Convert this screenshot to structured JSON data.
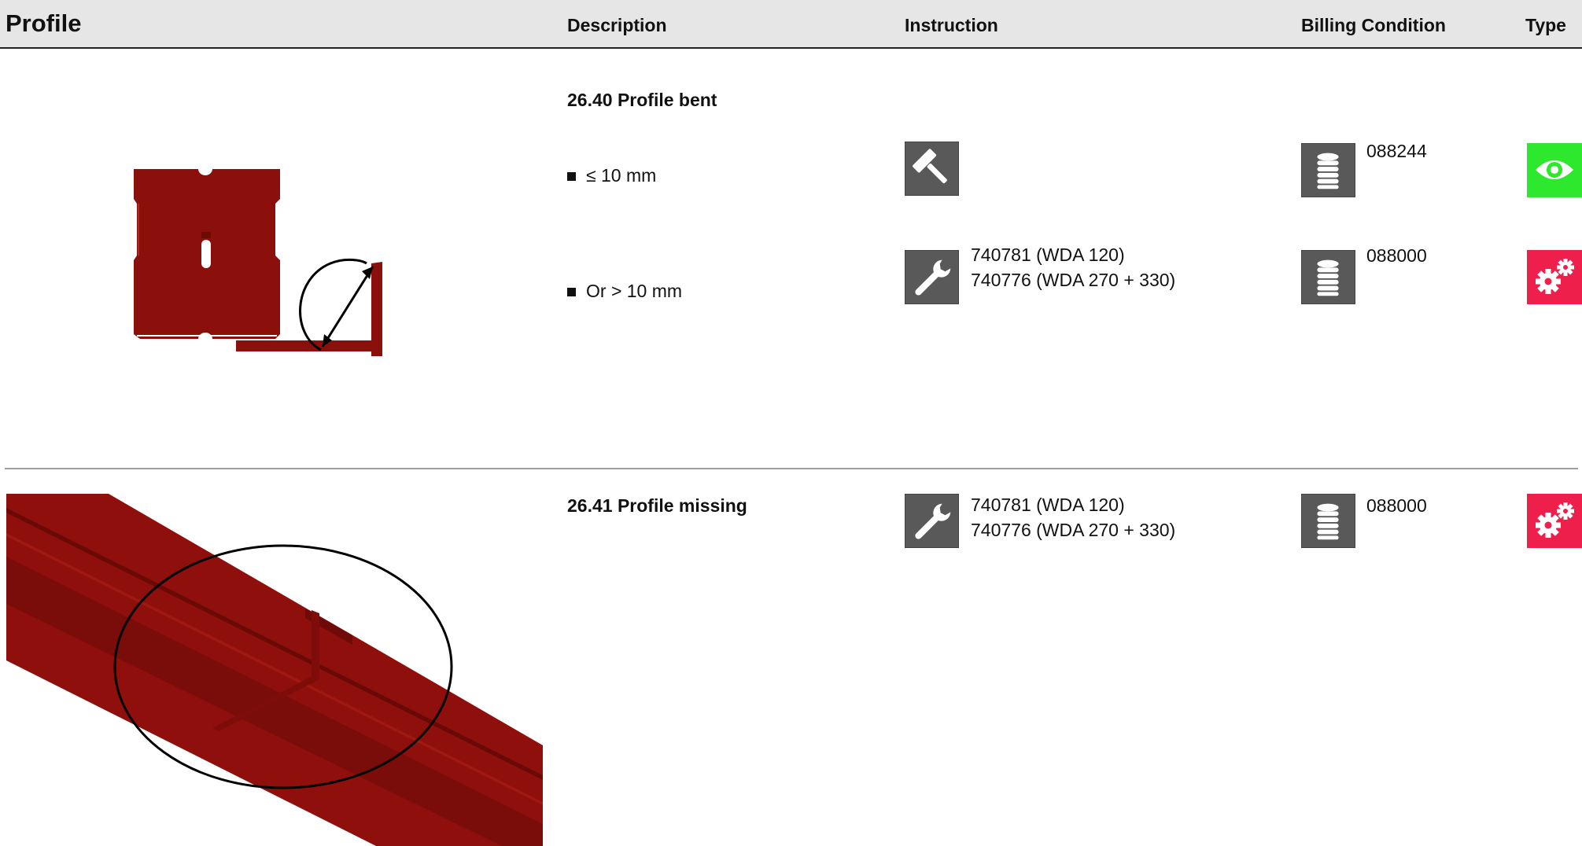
{
  "header": {
    "title": "Profile",
    "columns": {
      "description": "Description",
      "instruction": "Instruction",
      "billing": "Billing Condition",
      "type": "Type"
    }
  },
  "sections": [
    {
      "title": "26.40 Profile bent",
      "rows": [
        {
          "bullet": "≤ 10 mm",
          "instruction_icon": "hammer-icon",
          "instruction_lines": [],
          "billing_icon": "coin-stack-icon",
          "billing_code": "088244",
          "type_icon": "eye-icon",
          "type_color": "#2ee82e"
        },
        {
          "bullet": "Or > 10 mm",
          "instruction_icon": "wrench-icon",
          "instruction_lines": [
            "740781 (WDA 120)",
            "740776 (WDA 270 + 330)"
          ],
          "billing_icon": "coin-stack-icon",
          "billing_code": "088000",
          "type_icon": "gears-icon",
          "type_color": "#ee1f4a"
        }
      ]
    },
    {
      "title": "26.41 Profile missing",
      "rows": [
        {
          "instruction_icon": "wrench-icon",
          "instruction_lines": [
            "740781 (WDA 120)",
            "740776 (WDA 270 + 330)"
          ],
          "billing_icon": "coin-stack-icon",
          "billing_code": "088000",
          "type_icon": "gears-icon",
          "type_color": "#ee1f4a"
        }
      ]
    }
  ]
}
